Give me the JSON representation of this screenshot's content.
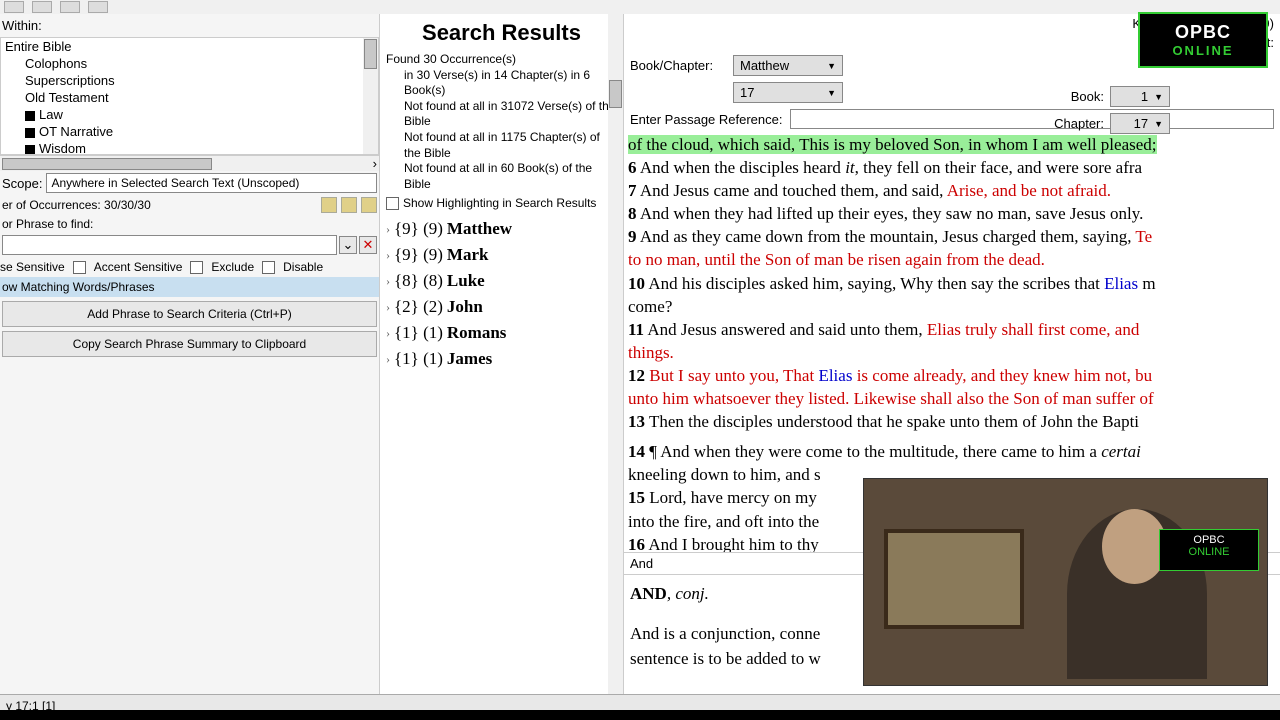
{
  "toolbar": {},
  "left": {
    "within_label": "Within:",
    "scope_items": [
      "Entire Bible",
      "Colophons",
      "Superscriptions",
      "Old Testament",
      "Law",
      "OT Narrative",
      "Wisdom"
    ],
    "scope_label": "Scope:",
    "scope_value": "Anywhere in Selected Search Text (Unscoped)",
    "occurrences": "er of Occurrences: 30/30/30",
    "find_label": "or Phrase to find:",
    "checks": {
      "case": "se Sensitive",
      "accent": "Accent Sensitive",
      "exclude": "Exclude",
      "disable": "Disable"
    },
    "hl_label": "ow Matching Words/Phrases",
    "btn_add": "Add Phrase to Search Criteria (Ctrl+P)",
    "btn_copy": "Copy Search Phrase Summary to Clipboard"
  },
  "mid": {
    "title": "Search Results",
    "found": "Found 30 Occurrence(s)",
    "in_verses": "in 30 Verse(s) in 14 Chapter(s) in 6 Book(s)",
    "not1": "Not found at all in 31072 Verse(s) of the Bible",
    "not2": "Not found at all in 1175 Chapter(s) of the Bible",
    "not3": "Not found at all in 60 Book(s) of the Bible",
    "hl_check": "Show Highlighting in Search Results",
    "tree": [
      {
        "counts": "{9} (9)",
        "book": "Matthew"
      },
      {
        "counts": "{9} (9)",
        "book": "Mark"
      },
      {
        "counts": "{8} (8)",
        "book": "Luke"
      },
      {
        "counts": "{2} (2)",
        "book": "John"
      },
      {
        "counts": "{1} (1)",
        "book": "Romans"
      },
      {
        "counts": "{1} (1)",
        "book": "James"
      }
    ]
  },
  "right": {
    "bible": "King James Bible (1769)",
    "testament": "New Testament:",
    "book_chapter_label": "Book/Chapter:",
    "book_label": "Book:",
    "chapter_label": "Chapter:",
    "book_combo": "Matthew",
    "chapter_combo": "17",
    "book_num": "1",
    "book_ch": "17",
    "ref_label": "Enter Passage Reference:",
    "verses": {
      "v5b": "of the cloud, which said, This is my beloved Son, in whom I am well pleased;",
      "v6a": "And when the disciples heard ",
      "v6it": "it",
      "v6b": ", they fell on their face, and were sore afra",
      "v7a": "And Jesus came and touched them, and said, ",
      "v7r": "Arise, and be not afraid.",
      "v8": "And when they had lifted up their eyes, they saw no man, save Jesus only.",
      "v9a": "And as they came down from the mountain, Jesus charged them, saying, ",
      "v9r": "Te",
      "v9r2": "to no man, until the Son of man be risen again from the dead.",
      "v10a": "And his disciples asked him, saying, Why then say the scribes that ",
      "v10b": "Elias",
      "v10c": " m",
      "v10d": "come?",
      "v11a": "And Jesus answered and said unto them, ",
      "v11r1": "Elias truly shall first come, and ",
      "v11r2": "things.",
      "v12r1": "But I say unto you, That ",
      "v12b": "Elias",
      "v12r2": " is come already, and they knew him not, bu",
      "v12r3": "unto him whatsoever they listed. Likewise shall also the Son of man suffer of",
      "v13": "Then the disciples understood that he spake unto them of John the Bapti",
      "v14a": "¶ And when they were come to the multitude, there came to him a ",
      "v14it": "certai",
      "v14b": "kneeling down to him, and s",
      "v15a": "Lord, have mercy on my",
      "v15b": "into the fire, and oft into the",
      "v16": "And I brought him to thy"
    },
    "dict_word": "And",
    "dict_entry_term": "AND",
    "dict_entry_pos": ", conj.",
    "dict_body": "And is a conjunction, conne",
    "dict_body2": "sentence is to be added to w"
  },
  "logo": {
    "l1": "OPBC",
    "l2": "ONLINE"
  },
  "status": "y 17:1 [1]"
}
